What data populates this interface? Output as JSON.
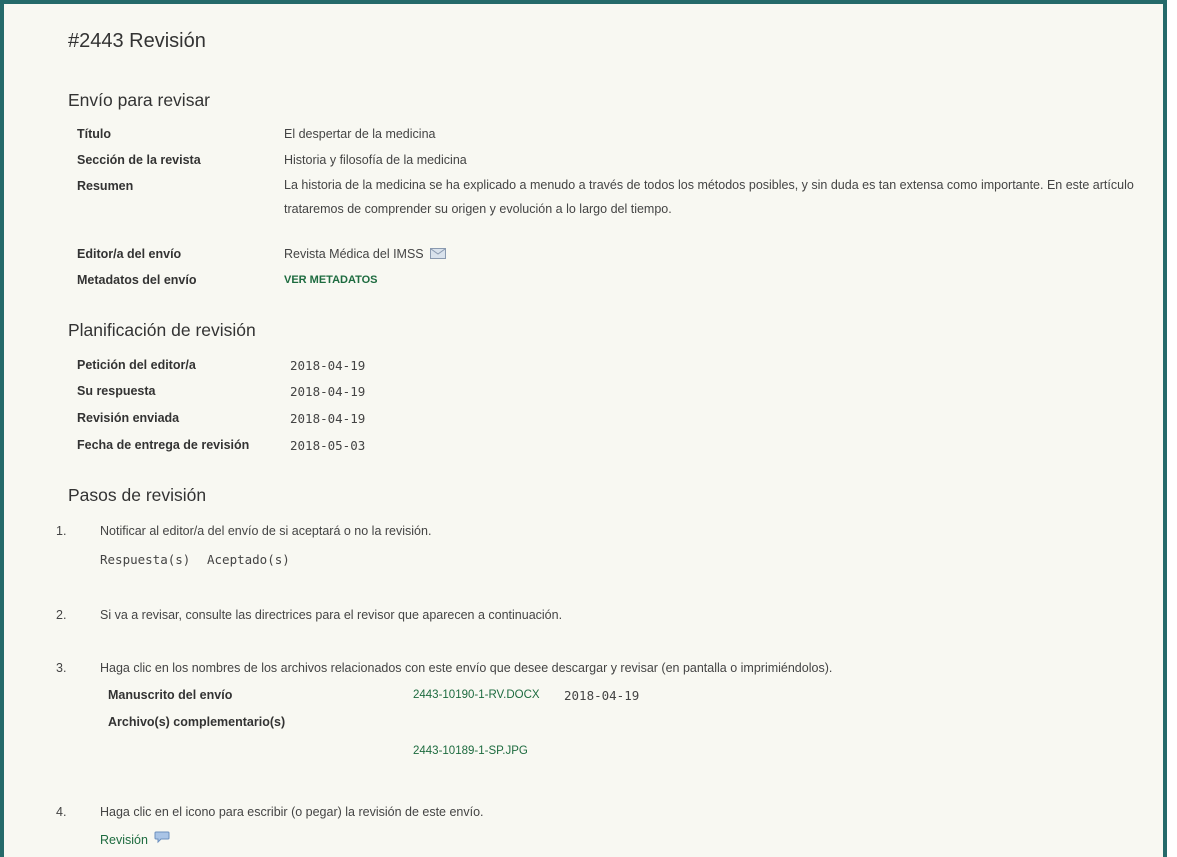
{
  "page": {
    "title": "#2443 Revisión"
  },
  "submission": {
    "heading": "Envío para revisar",
    "title_label": "Título",
    "title_value": "El despertar de la medicina",
    "section_label": "Sección de la revista",
    "section_value": "Historia y filosofía de la medicina",
    "abstract_label": "Resumen",
    "abstract_value": "La historia de la medicina se ha explicado a menudo a través de todos los métodos posibles, y sin duda es tan extensa como importante. En este artículo trataremos de comprender su origen y evolución a lo largo del tiempo.",
    "editor_label": "Editor/a del envío",
    "editor_value": "Revista Médica del IMSS",
    "metadata_label": "Metadatos del envío",
    "metadata_link": "VER METADATOS"
  },
  "schedule": {
    "heading": "Planificación de revisión",
    "rows": [
      {
        "label": "Petición del editor/a",
        "value": "2018-04-19"
      },
      {
        "label": "Su respuesta",
        "value": "2018-04-19"
      },
      {
        "label": "Revisión enviada",
        "value": "2018-04-19"
      },
      {
        "label": "Fecha de entrega de revisión",
        "value": "2018-05-03"
      }
    ]
  },
  "steps": {
    "heading": "Pasos de revisión",
    "step1": {
      "number": "1.",
      "text": "Notificar al editor/a del envío de si aceptará o no la revisión.",
      "response_label": "Respuesta(s)",
      "response_value": "Aceptado(s)"
    },
    "step2": {
      "number": "2.",
      "text": "Si va a revisar, consulte las directrices para el revisor que aparecen a continuación."
    },
    "step3": {
      "number": "3.",
      "text": "Haga clic en los nombres de los archivos relacionados con este envío que desee descargar y revisar (en pantalla o imprimiéndolos).",
      "manuscript_label": "Manuscrito del envío",
      "manuscript_file": "2443-10190-1-RV.DOCX",
      "manuscript_date": "2018-04-19",
      "supp_label": "Archivo(s) complementario(s)",
      "supp_file": "2443-10189-1-SP.JPG"
    },
    "step4": {
      "number": "4.",
      "text": "Haga clic en el icono para escribir (o pegar) la revisión de este envío.",
      "review_link": "Revisión"
    }
  },
  "icons": {
    "email": "envelope-icon",
    "comment": "speech-bubble-icon"
  },
  "colors": {
    "border": "#256a6a",
    "background": "#f8f8f2",
    "link": "#1d6b3f"
  }
}
